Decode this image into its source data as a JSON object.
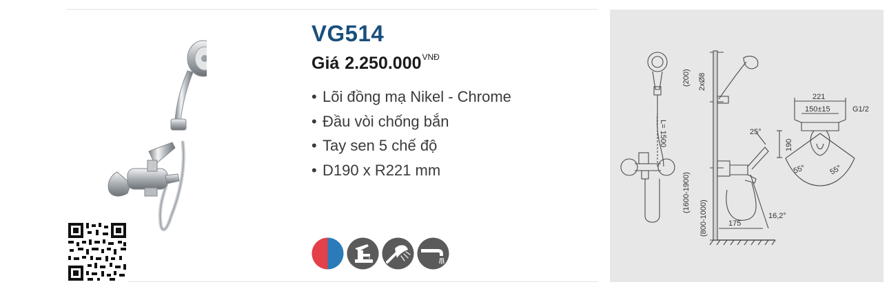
{
  "product": {
    "model": "VG514",
    "price_label": "Giá",
    "price_value": "2.250.000",
    "price_currency": "VNĐ"
  },
  "features": [
    "Lõi đồng mạ Nikel - Chrome",
    "Đầu vòi chống bắn",
    "Tay sen 5 chế độ",
    "D190 x R221 mm"
  ],
  "feature_icons": [
    "hot-cold-icon",
    "faucet-icon",
    "shower-head-icon",
    "spout-icon"
  ],
  "colors": {
    "model": "#1a4f7c",
    "hot": "#e4404a",
    "cold": "#2a7bb8",
    "icon_bg": "#5a5a5a",
    "diagram_bg": "#e7e7e7"
  },
  "diagram": {
    "dim_200": "(200)",
    "dim_2x08": "2xØ8",
    "dim_hose": "L= 1500",
    "dim_25deg": "25°",
    "dim_1600_1900": "(1600-1900)",
    "dim_800_1000": "(800-1000)",
    "dim_175": "175",
    "dim_162deg": "16,2°",
    "dim_221": "221",
    "dim_150": "150±15",
    "dim_g12": "G1/2",
    "dim_190": "190",
    "dim_55_left": "55°",
    "dim_55_right": "55°"
  }
}
